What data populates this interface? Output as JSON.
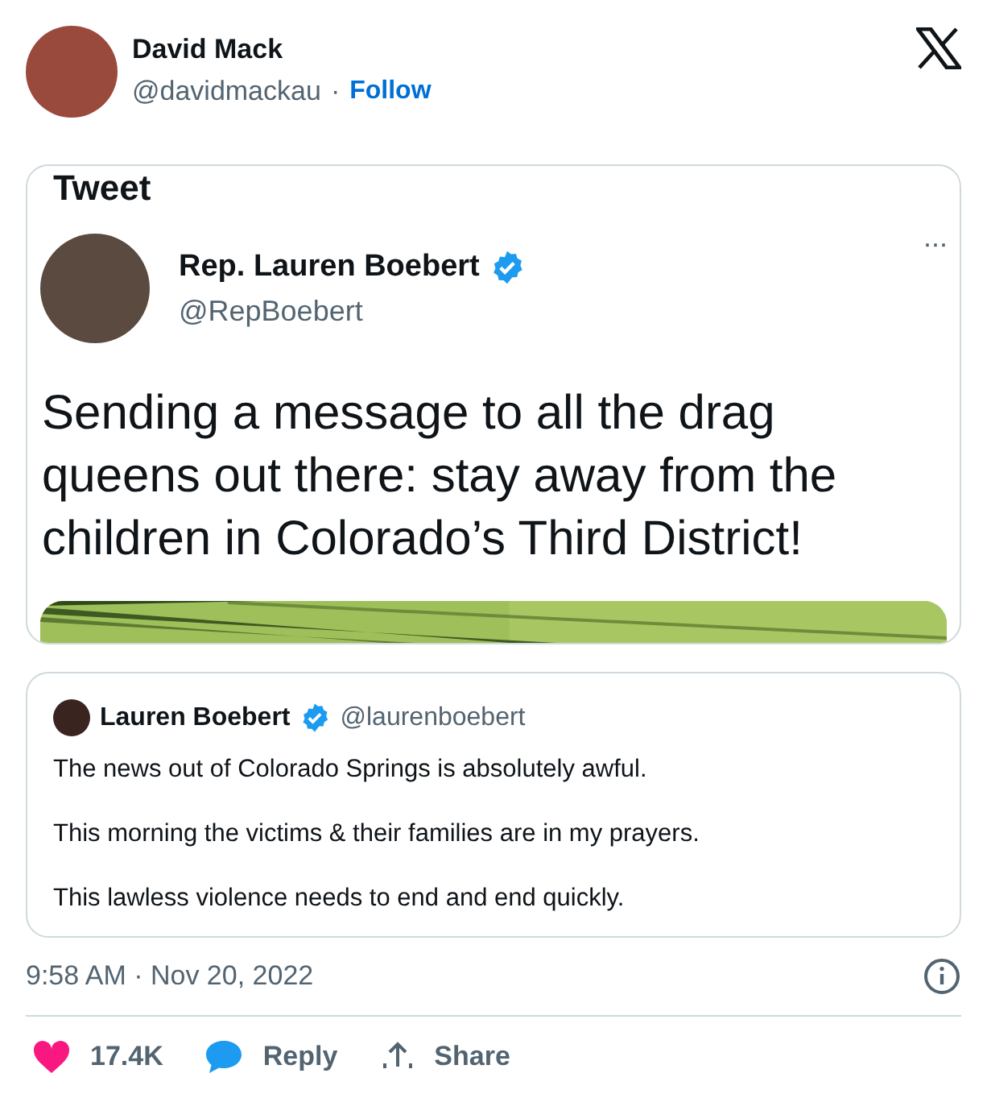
{
  "author": {
    "name": "David Mack",
    "handle": "@davidmackau",
    "separator": "·",
    "follow": "Follow"
  },
  "embedded_screenshot": {
    "header": "Tweet",
    "author": {
      "name": "Rep. Lauren Boebert",
      "handle": "@RepBoebert",
      "verified": true
    },
    "more": "···",
    "text": "Sending a message to all the drag queens out there: stay away from the children in Colorado’s Third District!"
  },
  "quoted_tweet": {
    "author": {
      "name": "Lauren Boebert",
      "handle": "@laurenboebert",
      "verified": true
    },
    "paragraphs": [
      "The news out of Colorado Springs is absolutely awful.",
      "This morning the victims & their families are in my prayers.",
      "This lawless violence needs to end and end quickly."
    ]
  },
  "timestamp": "9:58 AM · Nov 20, 2022",
  "actions": [
    {
      "kind": "like",
      "label": "17.4K"
    },
    {
      "kind": "reply",
      "label": "Reply"
    },
    {
      "kind": "share",
      "label": "Share"
    }
  ]
}
